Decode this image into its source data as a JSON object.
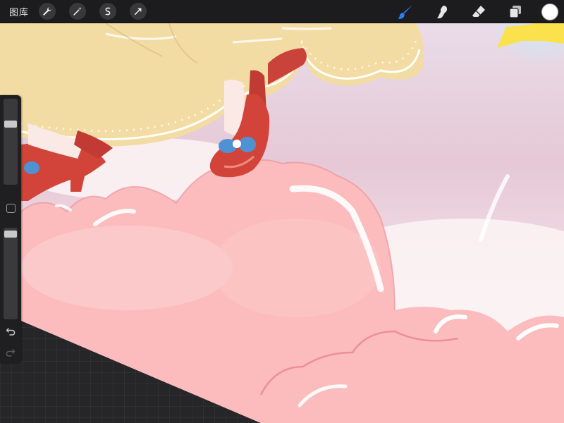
{
  "toolbar": {
    "gallery_label": "图库",
    "left_tools": [
      {
        "name": "actions-wrench-icon"
      },
      {
        "name": "adjustments-wand-icon"
      },
      {
        "name": "selection-icon"
      },
      {
        "name": "transform-arrow-icon"
      }
    ],
    "right_tools": [
      {
        "name": "brush-icon",
        "active": true,
        "color": "#2f7cf6"
      },
      {
        "name": "smudge-icon"
      },
      {
        "name": "eraser-icon"
      },
      {
        "name": "layers-icon"
      }
    ],
    "current_color": "#ffffff"
  },
  "sidebar": {
    "brush_size_level": 0.28,
    "opacity_level": 0.03
  },
  "colors": {
    "sky_pink": "#ecd1dd",
    "cloud_pink": "#fcbcbd",
    "hat_yellow": "#f3dca4",
    "shoe_red": "#d2443a",
    "bow_blue": "#4f92d4",
    "star_yellow": "#fbe24c"
  }
}
